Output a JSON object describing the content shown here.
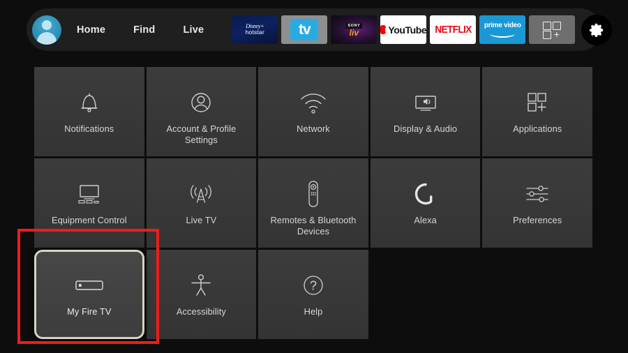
{
  "topbar": {
    "avatar_name": "profile-avatar",
    "nav": [
      {
        "label": "Home",
        "name": "nav-home"
      },
      {
        "label": "Find",
        "name": "nav-find"
      },
      {
        "label": "Live",
        "name": "nav-live"
      }
    ],
    "apps": [
      {
        "name": "app-disney-hotstar",
        "line1": "Disney+",
        "line2": "hotstar"
      },
      {
        "name": "app-apple-tv",
        "line1": "tv",
        "line2": ""
      },
      {
        "name": "app-sony-liv",
        "line1": "SONY",
        "line2": "liv"
      },
      {
        "name": "app-youtube",
        "line1": "YouTube",
        "line2": ""
      },
      {
        "name": "app-netflix",
        "line1": "NETFLIX",
        "line2": ""
      },
      {
        "name": "app-prime-video",
        "line1": "prime video",
        "line2": ""
      },
      {
        "name": "app-all-apps",
        "line1": "",
        "line2": ""
      }
    ],
    "settings_button_label": "Settings"
  },
  "grid": {
    "tiles": [
      {
        "label": "Notifications",
        "icon": "bell-icon"
      },
      {
        "label": "Account & Profile Settings",
        "icon": "person-circle-icon"
      },
      {
        "label": "Network",
        "icon": "wifi-icon"
      },
      {
        "label": "Display & Audio",
        "icon": "display-audio-icon"
      },
      {
        "label": "Applications",
        "icon": "apps-grid-icon"
      },
      {
        "label": "Equipment Control",
        "icon": "tv-equipment-icon"
      },
      {
        "label": "Live TV",
        "icon": "broadcast-tower-icon"
      },
      {
        "label": "Remotes & Bluetooth Devices",
        "icon": "remote-control-icon"
      },
      {
        "label": "Alexa",
        "icon": "alexa-ring-icon"
      },
      {
        "label": "Preferences",
        "icon": "sliders-icon"
      },
      {
        "label": "My Fire TV",
        "icon": "fire-tv-stick-icon",
        "focused": true
      },
      {
        "label": "Accessibility",
        "icon": "accessibility-person-icon"
      },
      {
        "label": "Help",
        "icon": "question-mark-circle-icon"
      }
    ]
  },
  "annotation": {
    "name": "red-highlight-box",
    "color": "#ee1c1c",
    "target": "My Fire TV"
  },
  "colors": {
    "background": "#0d0d0d",
    "topbar": "#1f1f1f",
    "tile": "#3c3c3c",
    "focus_border": "#d9d2c4",
    "annotation_red": "#ee1c1c",
    "text": "#d7d7d7"
  }
}
